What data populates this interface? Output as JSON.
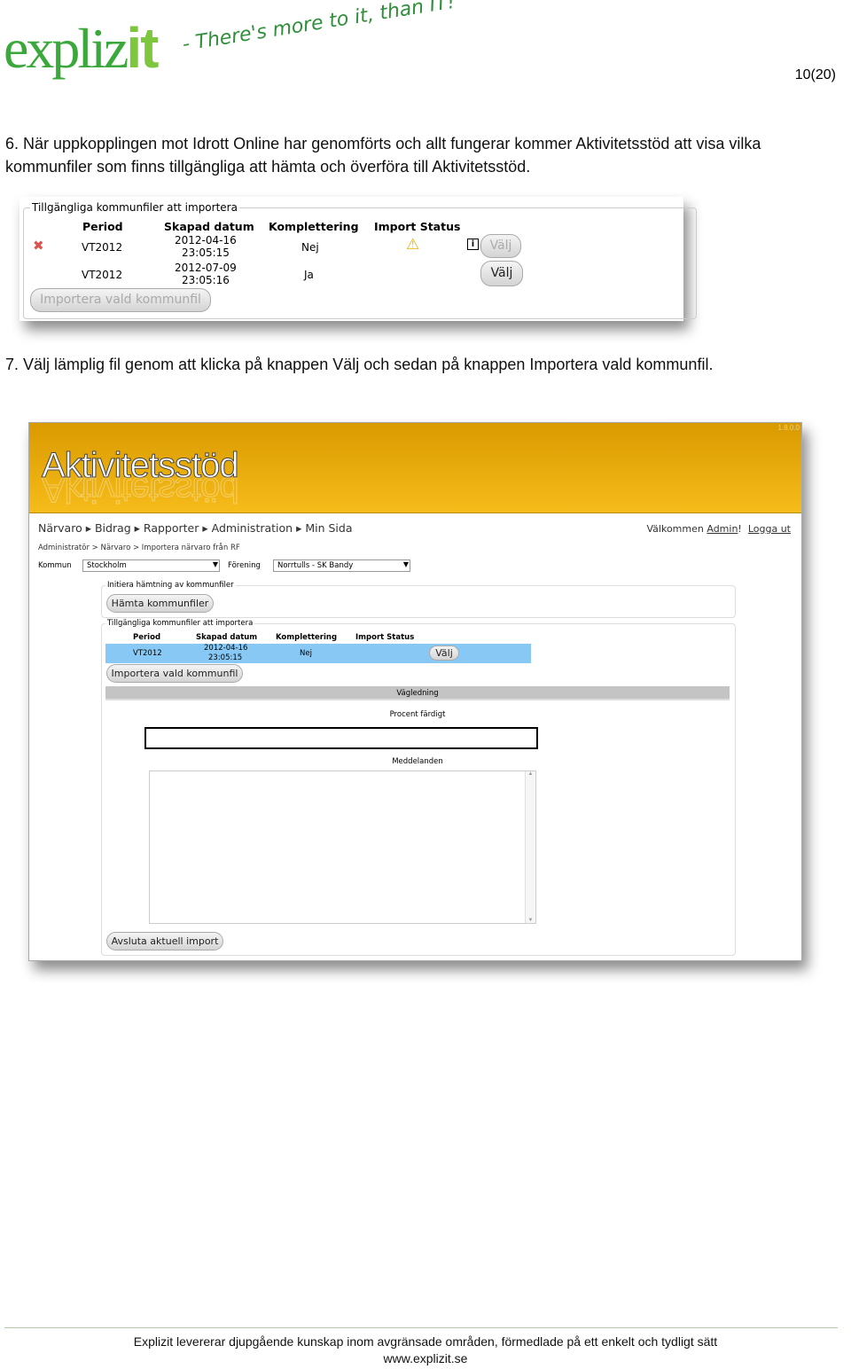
{
  "header": {
    "logo_text": "explizit",
    "tagline": "- There's more to it, than IT!",
    "page_number": "10(20)"
  },
  "step6": "6. När uppkopplingen mot Idrott Online har genomförts och allt fungerar kommer Aktivitetsstöd att visa vilka kommunfiler som finns tillgängliga att hämta och överföra till Aktivitetsstöd.",
  "shot1": {
    "legend": "Tillgängliga kommunfiler att importera",
    "columns": [
      "Period",
      "Skapad datum",
      "Komplettering",
      "Import Status"
    ],
    "rows": [
      {
        "period": "VT2012",
        "date": "2012-04-16",
        "time": "23:05:15",
        "komplettering": "Nej",
        "status_icon": "warning-icon",
        "delete_icon": "red-x-icon",
        "info_icon": "info-icon",
        "select": "Välj",
        "select_disabled": true
      },
      {
        "period": "VT2012",
        "date": "2012-07-09",
        "time": "23:05:16",
        "komplettering": "Ja",
        "select": "Välj",
        "select_disabled": false
      }
    ],
    "import_button": "Importera vald kommunfil"
  },
  "step7": "7. Välj lämplig fil genom att klicka på knappen Välj och sedan på knappen Importera vald kommunfil.",
  "shot2": {
    "app_title": "Aktivitetsstöd",
    "version": "1.8.0.0",
    "header_color": "#f2b10f",
    "nav": [
      "Närvaro",
      "Bidrag",
      "Rapporter",
      "Administration",
      "Min Sida"
    ],
    "welcome": "Välkommen",
    "user": "Admin",
    "exclam": "!",
    "logout": "Logga ut",
    "breadcrumb": "Administratör > Närvaro > Importera närvaro från RF",
    "kommun_label": "Kommun",
    "kommun_value": "Stockholm",
    "forening_label": "Förening",
    "forening_value": "Norrtulls - SK Bandy",
    "fetch_legend": "Initiera hämtning av kommunfiler",
    "fetch_button": "Hämta kommunfiler",
    "files_legend": "Tillgängliga kommunfiler att importera",
    "columns": [
      "Period",
      "Skapad datum",
      "Komplettering",
      "Import Status"
    ],
    "row": {
      "period": "VT2012",
      "date": "2012-04-16",
      "time": "23:05:15",
      "komplettering": "Nej",
      "select": "Välj"
    },
    "selected_row_color": "#87c8f5",
    "import_button": "Importera vald kommunfil",
    "guide_header": "Vägledning",
    "progress_label": "Procent färdigt",
    "progress": 0,
    "messages_label": "Meddelanden",
    "messages_value": "",
    "abort_button": "Avsluta aktuell import"
  },
  "footer": {
    "line1": "Explizit levererar djupgående kunskap inom avgränsade områden, förmedlade på ett enkelt och tydligt sätt",
    "line2": "www.explizit.se"
  }
}
